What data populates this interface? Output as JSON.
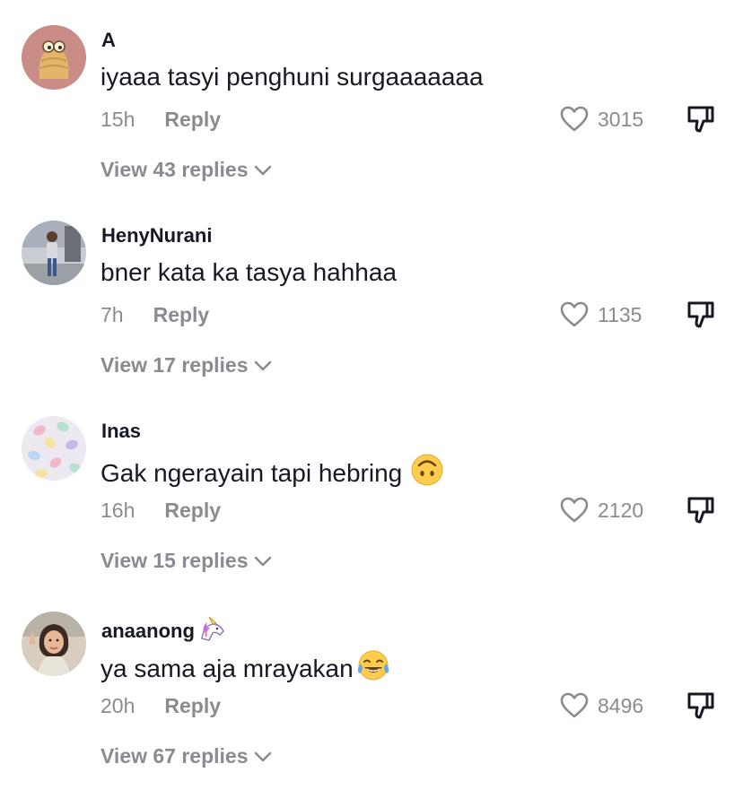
{
  "comments": [
    {
      "username": "A",
      "text": "iyaaa tasyi penghuni surgaaaaaaa",
      "time": "15h",
      "reply_label": "Reply",
      "likes": "3015",
      "view_replies": "View 43 replies",
      "avatar_icon": "cartoon-character-avatar"
    },
    {
      "username": "HenyNurani",
      "text": "bner kata ka tasya hahhaa",
      "time": "7h",
      "reply_label": "Reply",
      "likes": "1135",
      "view_replies": "View 17 replies",
      "avatar_icon": "person-photo-avatar"
    },
    {
      "username": "Inas",
      "text": "Gak ngerayain tapi hebring",
      "time": "16h",
      "reply_label": "Reply",
      "likes": "2120",
      "view_replies": "View 15 replies",
      "text_emoji": "upside-down-face-emoji",
      "avatar_icon": "macarons-avatar"
    },
    {
      "username": "anaanong",
      "username_emoji": "unicorn-emoji",
      "text": "ya sama aja mrayakan",
      "time": "20h",
      "reply_label": "Reply",
      "likes": "8496",
      "view_replies": "View 67 replies",
      "text_emoji": "tears-of-joy-emoji",
      "avatar_icon": "selfie-avatar"
    }
  ],
  "colors": {
    "text_primary": "#161823",
    "text_secondary": "#8a8b91",
    "background": "#ffffff"
  }
}
